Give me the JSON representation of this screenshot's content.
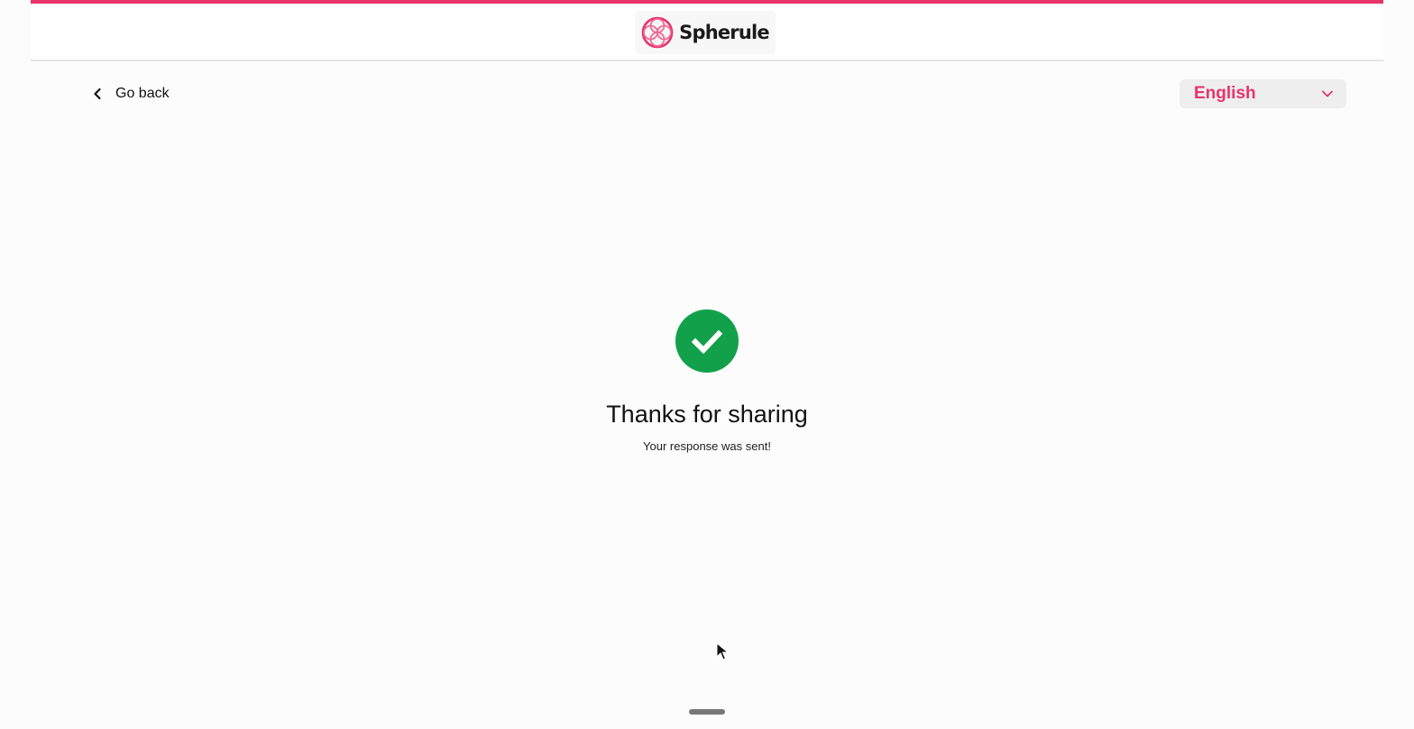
{
  "brand": {
    "name": "Spherule",
    "accent_color": "#e8336b",
    "logo_icon": "spherule-logo-icon"
  },
  "nav": {
    "back_label": "Go back",
    "back_icon": "chevron-left-icon"
  },
  "language_select": {
    "selected": "English",
    "icon": "chevron-down-icon"
  },
  "confirmation": {
    "icon": "check-circle-icon",
    "icon_color": "#12a14a",
    "title": "Thanks for sharing",
    "message": "Your response was sent!"
  }
}
